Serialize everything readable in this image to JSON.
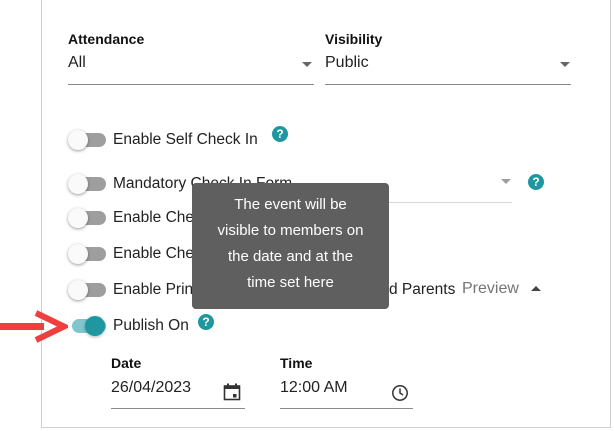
{
  "filters": {
    "attendance": {
      "label": "Attendance",
      "value": "All"
    },
    "visibility": {
      "label": "Visibility",
      "value": "Public"
    }
  },
  "options": {
    "self_check_in": "Enable Self Check In",
    "mandatory_form": "Mandatory Check In Form",
    "check_a": "Enable Che",
    "check_b": "Enable Che",
    "print_label": "Enable Prin",
    "print_tail": "d Parents",
    "publish_on": "Publish On"
  },
  "preview_link": "Preview",
  "tooltip": {
    "line1": "The event will be",
    "line2": "visible to members on",
    "line3": "the date and at the",
    "line4": "time set here"
  },
  "publish": {
    "date_label": "Date",
    "date_value": "26/04/2023",
    "time_label": "Time",
    "time_value": "12:00 AM"
  },
  "help_glyph": "?",
  "colors": {
    "accent": "#1e97a1",
    "tooltip_bg": "#5f5f5f",
    "annotation_arrow": "#ef3e3e"
  },
  "icons": {
    "calendar": "calendar-icon",
    "clock": "clock-icon",
    "help": "help-icon"
  }
}
